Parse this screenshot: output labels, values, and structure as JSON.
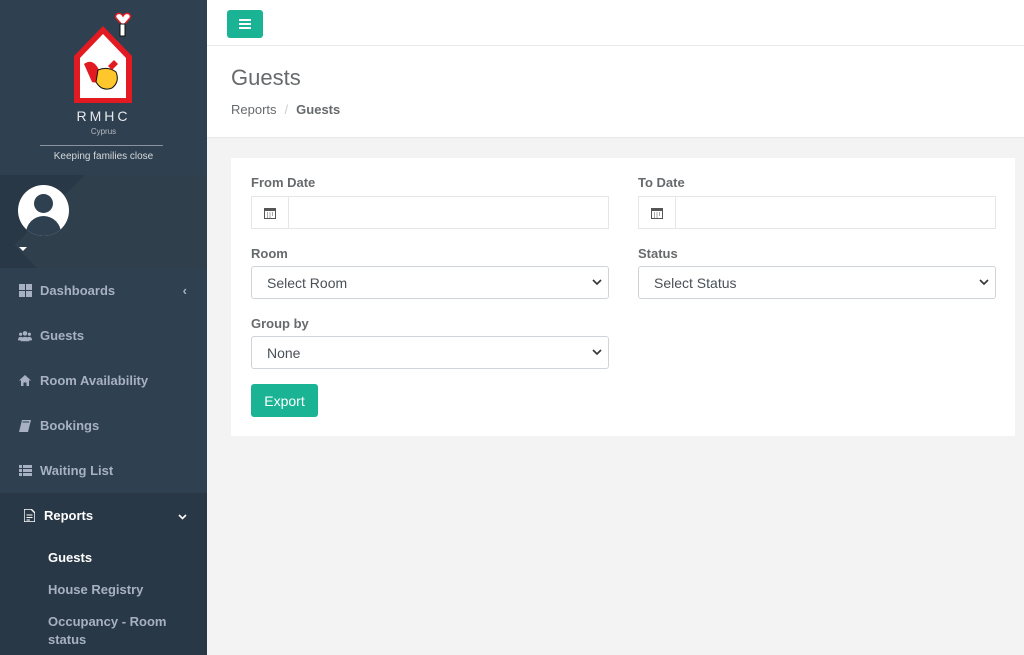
{
  "brand": {
    "name": "RMHC",
    "country": "Cyprus",
    "tagline": "Keeping families close"
  },
  "sidebar": {
    "items": [
      {
        "label": "Dashboards",
        "icon": "grid-icon"
      },
      {
        "label": "Guests",
        "icon": "users-icon"
      },
      {
        "label": "Room Availability",
        "icon": "home-icon"
      },
      {
        "label": "Bookings",
        "icon": "book-icon"
      },
      {
        "label": "Waiting List",
        "icon": "list-icon"
      },
      {
        "label": "Reports",
        "icon": "file-icon"
      }
    ],
    "sub_items": [
      {
        "label": "Guests"
      },
      {
        "label": "House Registry"
      },
      {
        "label": "Occupancy - Room status"
      }
    ]
  },
  "header": {
    "title": "Guests",
    "breadcrumb": {
      "parent": "Reports",
      "separator": "/",
      "current": "Guests"
    }
  },
  "form": {
    "from_date": {
      "label": "From Date",
      "value": ""
    },
    "to_date": {
      "label": "To Date",
      "value": ""
    },
    "room": {
      "label": "Room",
      "selected": "Select Room"
    },
    "status": {
      "label": "Status",
      "selected": "Select Status"
    },
    "group_by": {
      "label": "Group by",
      "selected": "None"
    },
    "export_label": "Export"
  },
  "colors": {
    "sidebar_bg": "#2f4050",
    "accent": "#1ab394",
    "page_bg": "#f3f3f4"
  }
}
